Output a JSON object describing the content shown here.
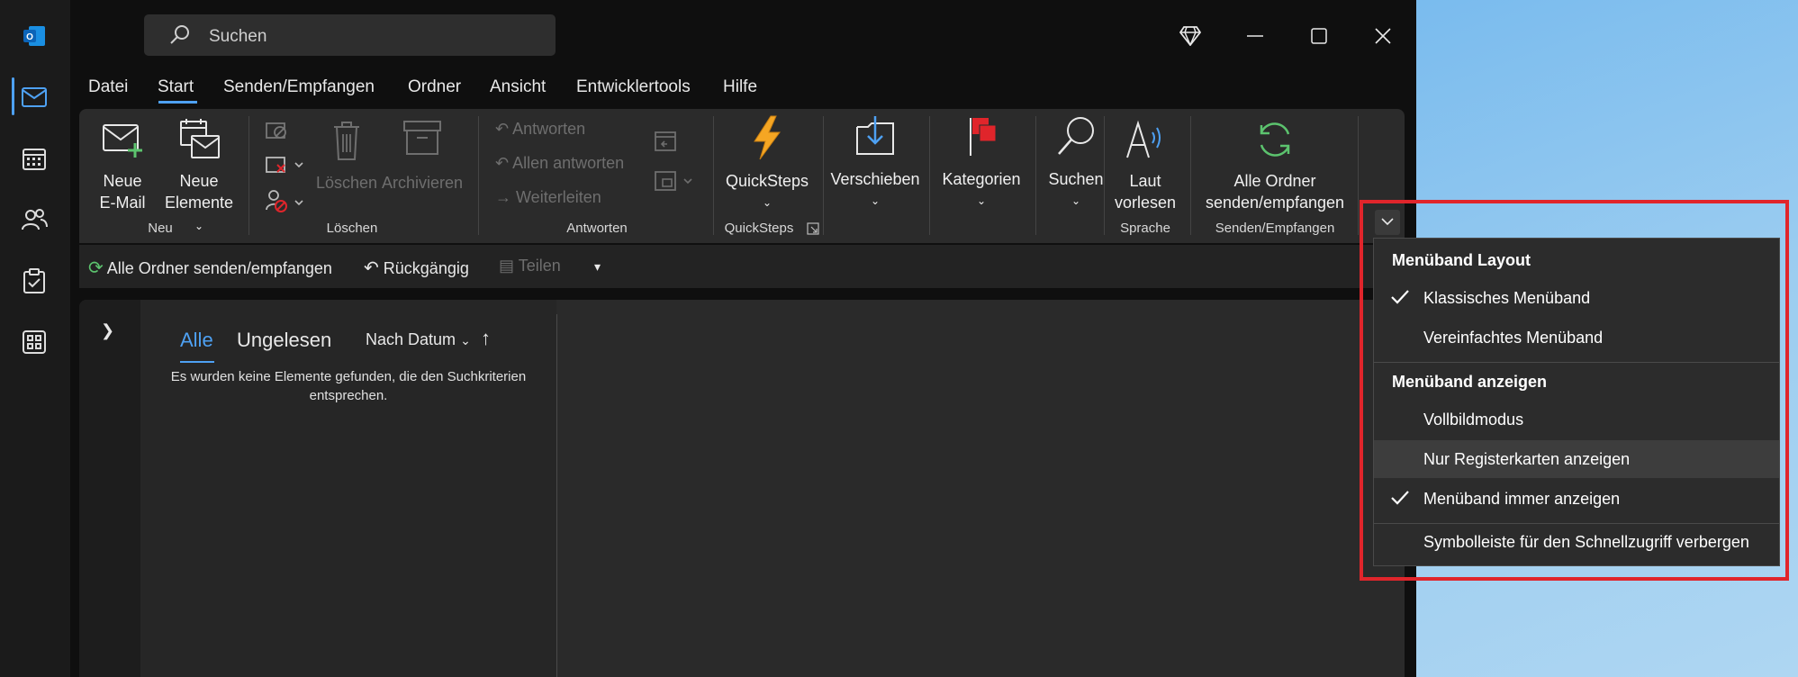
{
  "search": {
    "placeholder": "Suchen"
  },
  "menu_tabs": [
    "Datei",
    "Start",
    "Senden/Empfangen",
    "Ordner",
    "Ansicht",
    "Entwicklertools",
    "Hilfe"
  ],
  "ribbon": {
    "neue_email": [
      "Neue",
      "E-Mail"
    ],
    "neue_elemente": [
      "Neue",
      "Elemente"
    ],
    "loeschen": "Löschen",
    "archivieren": "Archivieren",
    "antworten": "Antworten",
    "allen_antworten": "Allen antworten",
    "weiterleiten": "Weiterleiten",
    "quicksteps": "QuickSteps",
    "verschieben": "Verschieben",
    "kategorien": "Kategorien",
    "suchen": "Suchen",
    "laut_vorlesen": [
      "Laut",
      "vorlesen"
    ],
    "alle_ordner": [
      "Alle Ordner",
      "senden/empfangen"
    ],
    "groups": [
      "Neu",
      "Löschen",
      "Antworten",
      "QuickSteps",
      "Sprache",
      "Senden/Empfangen"
    ]
  },
  "qat": {
    "alle_ordner": "Alle Ordner senden/empfangen",
    "rueckgaengig": "Rückgängig",
    "teilen": "Teilen"
  },
  "list": {
    "filter_alle": "Alle",
    "filter_ungelesen": "Ungelesen",
    "sort": "Nach Datum",
    "empty": "Es wurden keine Elemente gefunden, die den Suchkriterien entsprechen."
  },
  "dropdown": {
    "header1": "Menüband Layout",
    "klassisch": "Klassisches Menüband",
    "vereinfacht": "Vereinfachtes Menüband",
    "header2": "Menüband anzeigen",
    "vollbild": "Vollbildmodus",
    "nur_register": "Nur Registerkarten anzeigen",
    "immer": "Menüband immer anzeigen",
    "symbolleiste": "Symbolleiste für den Schnellzugriff verbergen"
  },
  "colors": {
    "accent": "#4ea1f3",
    "highlight": "#e0252b",
    "quicksteps_bolt": "#f5a623",
    "flag": "#e0252b"
  }
}
